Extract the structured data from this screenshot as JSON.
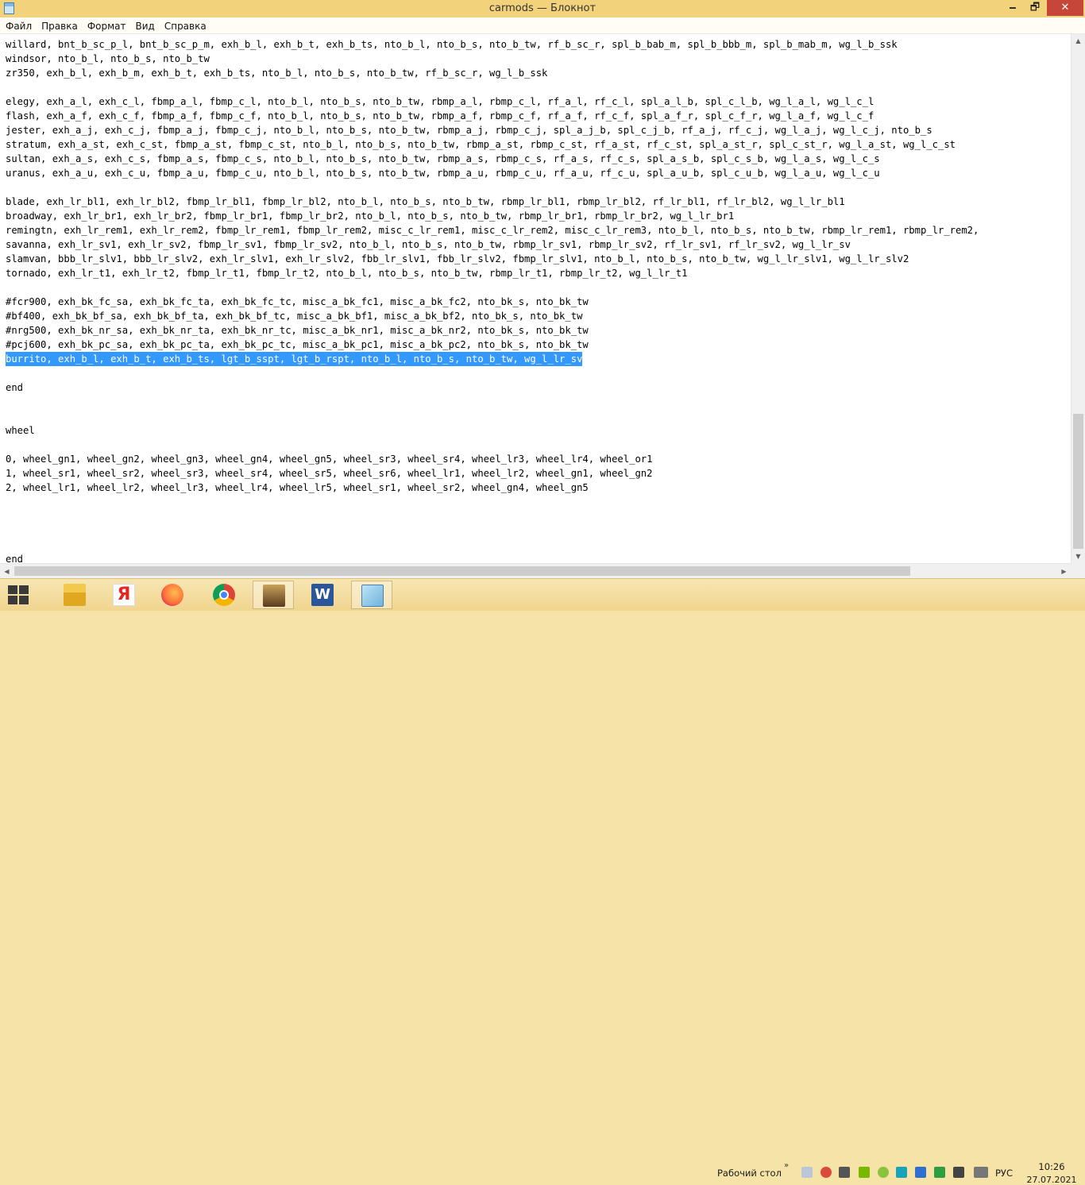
{
  "window": {
    "title": "carmods — Блокнот",
    "controls": {
      "minimize": "🗕",
      "maximize": "🗗",
      "close": "✕"
    }
  },
  "menu": [
    "Файл",
    "Правка",
    "Формат",
    "Вид",
    "Справка"
  ],
  "editor": {
    "lines": [
      "willard, bnt_b_sc_p_l, bnt_b_sc_p_m, exh_b_l, exh_b_t, exh_b_ts, nto_b_l, nto_b_s, nto_b_tw, rf_b_sc_r, spl_b_bab_m, spl_b_bbb_m, spl_b_mab_m, wg_l_b_ssk",
      "windsor, nto_b_l, nto_b_s, nto_b_tw",
      "zr350, exh_b_l, exh_b_m, exh_b_t, exh_b_ts, nto_b_l, nto_b_s, nto_b_tw, rf_b_sc_r, wg_l_b_ssk",
      "",
      "elegy, exh_a_l, exh_c_l, fbmp_a_l, fbmp_c_l, nto_b_l, nto_b_s, nto_b_tw, rbmp_a_l, rbmp_c_l, rf_a_l, rf_c_l, spl_a_l_b, spl_c_l_b, wg_l_a_l, wg_l_c_l",
      "flash, exh_a_f, exh_c_f, fbmp_a_f, fbmp_c_f, nto_b_l, nto_b_s, nto_b_tw, rbmp_a_f, rbmp_c_f, rf_a_f, rf_c_f, spl_a_f_r, spl_c_f_r, wg_l_a_f, wg_l_c_f",
      "jester, exh_a_j, exh_c_j, fbmp_a_j, fbmp_c_j, nto_b_l, nto_b_s, nto_b_tw, rbmp_a_j, rbmp_c_j, spl_a_j_b, spl_c_j_b, rf_a_j, rf_c_j, wg_l_a_j, wg_l_c_j, nto_b_s",
      "stratum, exh_a_st, exh_c_st, fbmp_a_st, fbmp_c_st, nto_b_l, nto_b_s, nto_b_tw, rbmp_a_st, rbmp_c_st, rf_a_st, rf_c_st, spl_a_st_r, spl_c_st_r, wg_l_a_st, wg_l_c_st",
      "sultan, exh_a_s, exh_c_s, fbmp_a_s, fbmp_c_s, nto_b_l, nto_b_s, nto_b_tw, rbmp_a_s, rbmp_c_s, rf_a_s, rf_c_s, spl_a_s_b, spl_c_s_b, wg_l_a_s, wg_l_c_s",
      "uranus, exh_a_u, exh_c_u, fbmp_a_u, fbmp_c_u, nto_b_l, nto_b_s, nto_b_tw, rbmp_a_u, rbmp_c_u, rf_a_u, rf_c_u, spl_a_u_b, spl_c_u_b, wg_l_a_u, wg_l_c_u",
      "",
      "blade, exh_lr_bl1, exh_lr_bl2, fbmp_lr_bl1, fbmp_lr_bl2, nto_b_l, nto_b_s, nto_b_tw, rbmp_lr_bl1, rbmp_lr_bl2, rf_lr_bl1, rf_lr_bl2, wg_l_lr_bl1",
      "broadway, exh_lr_br1, exh_lr_br2, fbmp_lr_br1, fbmp_lr_br2, nto_b_l, nto_b_s, nto_b_tw, rbmp_lr_br1, rbmp_lr_br2, wg_l_lr_br1",
      "remingtn, exh_lr_rem1, exh_lr_rem2, fbmp_lr_rem1, fbmp_lr_rem2, misc_c_lr_rem1, misc_c_lr_rem2, misc_c_lr_rem3, nto_b_l, nto_b_s, nto_b_tw, rbmp_lr_rem1, rbmp_lr_rem2,",
      "savanna, exh_lr_sv1, exh_lr_sv2, fbmp_lr_sv1, fbmp_lr_sv2, nto_b_l, nto_b_s, nto_b_tw, rbmp_lr_sv1, rbmp_lr_sv2, rf_lr_sv1, rf_lr_sv2, wg_l_lr_sv",
      "slamvan, bbb_lr_slv1, bbb_lr_slv2, exh_lr_slv1, exh_lr_slv2, fbb_lr_slv1, fbb_lr_slv2, fbmp_lr_slv1, nto_b_l, nto_b_s, nto_b_tw, wg_l_lr_slv1, wg_l_lr_slv2",
      "tornado, exh_lr_t1, exh_lr_t2, fbmp_lr_t1, fbmp_lr_t2, nto_b_l, nto_b_s, nto_b_tw, rbmp_lr_t1, rbmp_lr_t2, wg_l_lr_t1",
      "",
      "#fcr900, exh_bk_fc_sa, exh_bk_fc_ta, exh_bk_fc_tc, misc_a_bk_fc1, misc_a_bk_fc2, nto_bk_s, nto_bk_tw",
      "#bf400, exh_bk_bf_sa, exh_bk_bf_ta, exh_bk_bf_tc, misc_a_bk_bf1, misc_a_bk_bf2, nto_bk_s, nto_bk_tw",
      "#nrg500, exh_bk_nr_sa, exh_bk_nr_ta, exh_bk_nr_tc, misc_a_bk_nr1, misc_a_bk_nr2, nto_bk_s, nto_bk_tw",
      "#pcj600, exh_bk_pc_sa, exh_bk_pc_ta, exh_bk_pc_tc, misc_a_bk_pc1, misc_a_bk_pc2, nto_bk_s, nto_bk_tw",
      "burrito, exh_b_l, exh_b_t, exh_b_ts, lgt_b_sspt, lgt_b_rspt, nto_b_l, nto_b_s, nto_b_tw, wg_l_lr_sv",
      "",
      "end",
      "",
      "",
      "wheel",
      "",
      "0, wheel_gn1, wheel_gn2, wheel_gn3, wheel_gn4, wheel_gn5, wheel_sr3, wheel_sr4, wheel_lr3, wheel_lr4, wheel_or1",
      "1, wheel_sr1, wheel_sr2, wheel_sr3, wheel_sr4, wheel_sr5, wheel_sr6, wheel_lr1, wheel_lr2, wheel_gn1, wheel_gn2",
      "2, wheel_lr1, wheel_lr2, wheel_lr3, wheel_lr4, wheel_lr5, wheel_sr1, wheel_sr2, wheel_gn4, wheel_gn5",
      "",
      "",
      "",
      "",
      "end"
    ],
    "selected_line_index": 22,
    "selection_color": "#3399ff"
  },
  "taskbar": {
    "desktop_label": "Рабочий стол",
    "language": "РУС",
    "time": "10:26",
    "date": "27.07.2021",
    "pinned": [
      "file-explorer-icon",
      "yandex-browser-icon",
      "firefox-icon",
      "chrome-icon",
      "gta-sa-icon",
      "word-icon",
      "notepad-icon"
    ]
  }
}
